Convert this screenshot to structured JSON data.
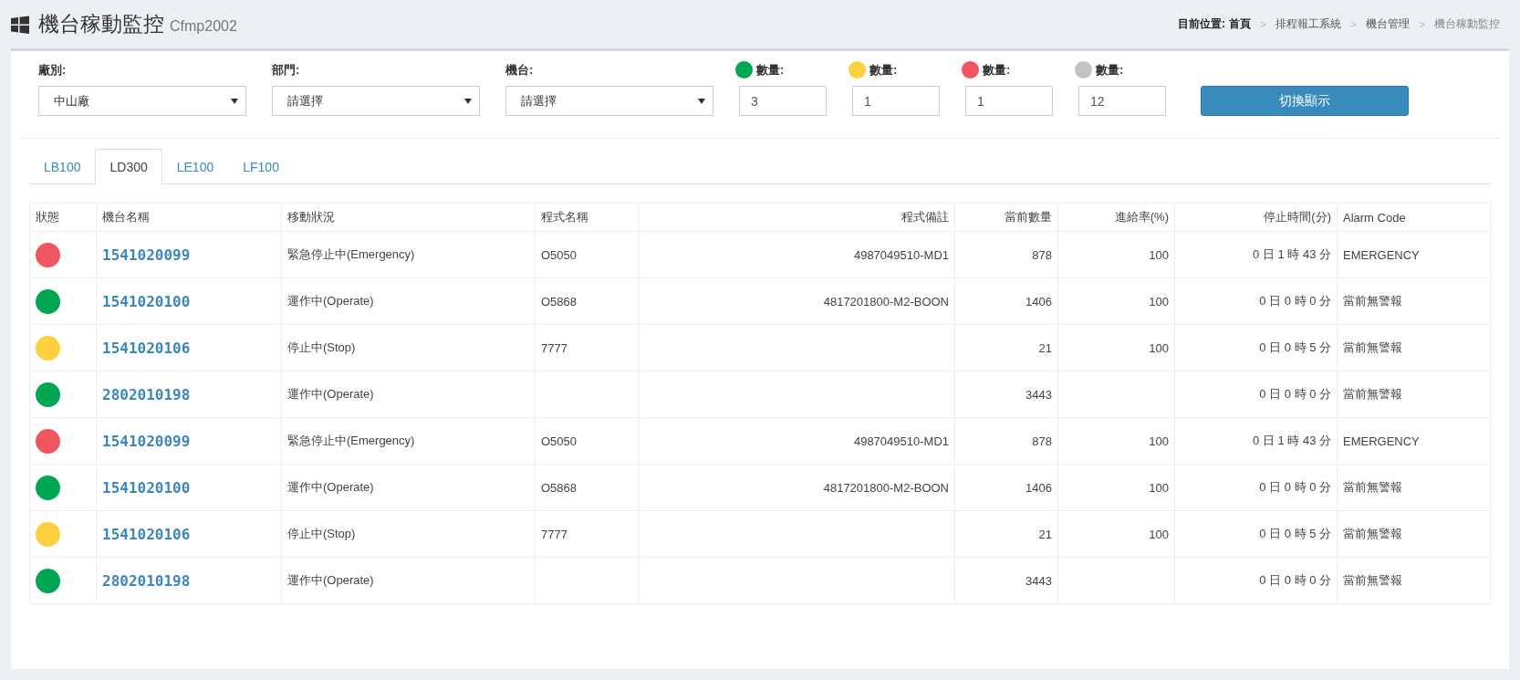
{
  "header": {
    "title": "機台稼動監控",
    "subtitle": "Cfmp2002"
  },
  "breadcrumb": {
    "label": "目前位置:",
    "separator": ">",
    "items": [
      {
        "text": "首頁",
        "current": false
      },
      {
        "text": "排程報工系統",
        "current": false
      },
      {
        "text": "機台管理",
        "current": false
      },
      {
        "text": "機台稼動監控",
        "current": true
      }
    ]
  },
  "filters": [
    {
      "label": "廠別:",
      "value": "中山廠"
    },
    {
      "label": "部門:",
      "value": "請選擇"
    },
    {
      "label": "機台:",
      "value": "請選擇"
    }
  ],
  "counts": [
    {
      "label": "數量:",
      "color": "#00a651",
      "value": "3"
    },
    {
      "label": "數量:",
      "color": "#fdd040",
      "value": "1"
    },
    {
      "label": "數量:",
      "color": "#f15660",
      "value": "1"
    },
    {
      "label": "數量:",
      "color": "#c3c3c3",
      "value": "12"
    }
  ],
  "toggle_button": "切換顯示",
  "tabs": [
    {
      "label": "LB100",
      "selected": false
    },
    {
      "label": "LD300",
      "selected": true
    },
    {
      "label": "LE100",
      "selected": false
    },
    {
      "label": "LF100",
      "selected": false
    }
  ],
  "table": {
    "columns": [
      "狀態",
      "機台名稱",
      "移動狀況",
      "程式名稱",
      "程式備註",
      "當前數量",
      "進給率(%)",
      "停止時間(分)",
      "Alarm Code"
    ],
    "rows": [
      {
        "color": "#f15660",
        "machine": "1541020099",
        "status": "緊急停止中(Emergency)",
        "program": "O5050",
        "note": "4987049510-MD1",
        "quantity": "878",
        "feed": "100",
        "stop_time": "0 日 1 時 43 分",
        "alarm": "EMERGENCY"
      },
      {
        "color": "#00a651",
        "machine": "1541020100",
        "status": "運作中(Operate)",
        "program": "O5868",
        "note": "4817201800-M2-BOON",
        "quantity": "1406",
        "feed": "100",
        "stop_time": "0 日 0 時 0 分",
        "alarm": "當前無警報"
      },
      {
        "color": "#fdd040",
        "machine": "1541020106",
        "status": "停止中(Stop)",
        "program": "7777",
        "quantity": "21",
        "feed": "100",
        "stop_time": "0 日 0 時 5 分",
        "alarm": "當前無警報"
      },
      {
        "color": "#00a651",
        "machine": "2802010198",
        "status": "運作中(Operate)",
        "quantity": "3443",
        "stop_time": "0 日 0 時 0 分",
        "alarm": "當前無警報"
      },
      {
        "color": "#f15660",
        "machine": "1541020099",
        "status": "緊急停止中(Emergency)",
        "program": "O5050",
        "note": "4987049510-MD1",
        "quantity": "878",
        "feed": "100",
        "stop_time": "0 日 1 時 43 分",
        "alarm": "EMERGENCY"
      },
      {
        "color": "#00a651",
        "machine": "1541020100",
        "status": "運作中(Operate)",
        "program": "O5868",
        "note": "4817201800-M2-BOON",
        "quantity": "1406",
        "feed": "100",
        "stop_time": "0 日 0 時 0 分",
        "alarm": "當前無警報"
      },
      {
        "color": "#fdd040",
        "machine": "1541020106",
        "status": "停止中(Stop)",
        "program": "7777",
        "quantity": "21",
        "feed": "100",
        "stop_time": "0 日 0 時 5 分",
        "alarm": "當前無警報"
      },
      {
        "color": "#00a651",
        "machine": "2802010198",
        "status": "運作中(Operate)",
        "quantity": "3443",
        "stop_time": "0 日 0 時 0 分",
        "alarm": "當前無警報"
      }
    ]
  }
}
